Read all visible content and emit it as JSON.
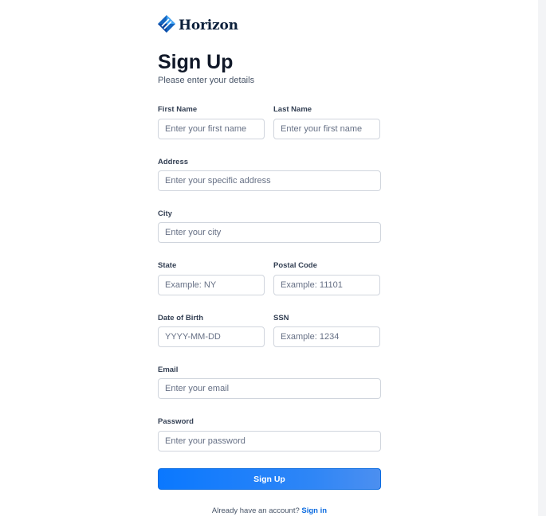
{
  "brand": {
    "name": "Horizon",
    "logo_icon": "horizon-logo-icon",
    "accent_color": "#1565c0"
  },
  "header": {
    "title": "Sign Up",
    "subtitle": "Please enter your details"
  },
  "form": {
    "first_name": {
      "label": "First Name",
      "placeholder": "Enter your first name",
      "value": ""
    },
    "last_name": {
      "label": "Last Name",
      "placeholder": "Enter your first name",
      "value": ""
    },
    "address": {
      "label": "Address",
      "placeholder": "Enter your specific address",
      "value": ""
    },
    "city": {
      "label": "City",
      "placeholder": "Enter your city",
      "value": ""
    },
    "state": {
      "label": "State",
      "placeholder": "Example: NY",
      "value": ""
    },
    "postal_code": {
      "label": "Postal Code",
      "placeholder": "Example: 11101",
      "value": ""
    },
    "dob": {
      "label": "Date of Birth",
      "placeholder": "YYYY-MM-DD",
      "value": ""
    },
    "ssn": {
      "label": "SSN",
      "placeholder": "Example: 1234",
      "value": ""
    },
    "email": {
      "label": "Email",
      "placeholder": "Enter your email",
      "value": ""
    },
    "password": {
      "label": "Password",
      "placeholder": "Enter your password",
      "value": ""
    },
    "submit_label": "Sign Up",
    "submit_color": "#0a78ff"
  },
  "footer": {
    "prompt": "Already have an account?",
    "link_label": "Sign in",
    "link_color": "#0b6be0"
  }
}
